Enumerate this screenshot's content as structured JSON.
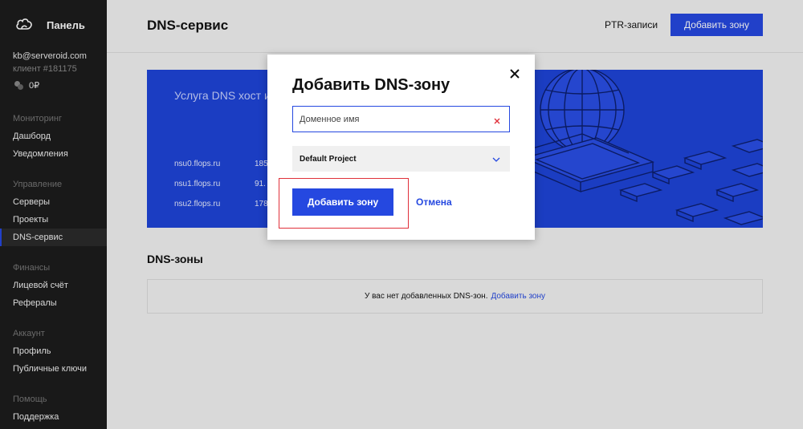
{
  "sidebar": {
    "brand": "Панель",
    "account": {
      "email": "kb@serveroid.com",
      "client": "клиент #181175",
      "balance": "0₽"
    },
    "sections": [
      {
        "title": "Мониторинг",
        "items": [
          "Дашборд",
          "Уведомления"
        ]
      },
      {
        "title": "Управление",
        "items": [
          "Серверы",
          "Проекты",
          "DNS-сервис"
        ]
      },
      {
        "title": "Финансы",
        "items": [
          "Лицевой счёт",
          "Рефералы"
        ]
      },
      {
        "title": "Аккаунт",
        "items": [
          "Профиль",
          "Публичные ключи"
        ]
      },
      {
        "title": "Помощь",
        "items": [
          "Поддержка"
        ]
      }
    ],
    "active_item": "DNS-сервис"
  },
  "header": {
    "title": "DNS-сервис",
    "ptr_link": "PTR-записи",
    "add_zone_button": "Добавить зону"
  },
  "banner": {
    "text": "Услуга DNS хост использования с серверы имен в",
    "nameservers": [
      {
        "name": "nsu0.flops.ru",
        "ip": "185"
      },
      {
        "name": "nsu1.flops.ru",
        "ip": "91."
      },
      {
        "name": "nsu2.flops.ru",
        "ip": "178"
      }
    ]
  },
  "zones": {
    "title": "DNS-зоны",
    "empty_text": "У вас нет добавленных DNS-зон.",
    "empty_link": "Добавить зону"
  },
  "modal": {
    "title": "Добавить DNS-зону",
    "domain_placeholder": "Доменное имя",
    "project_selected": "Default Project",
    "submit_label": "Добавить зону",
    "cancel_label": "Отмена"
  },
  "colors": {
    "accent": "#2548e0",
    "sidebar_bg": "#1c1c1c",
    "banner_bg": "#1f44d9",
    "highlight": "#e0303a"
  }
}
